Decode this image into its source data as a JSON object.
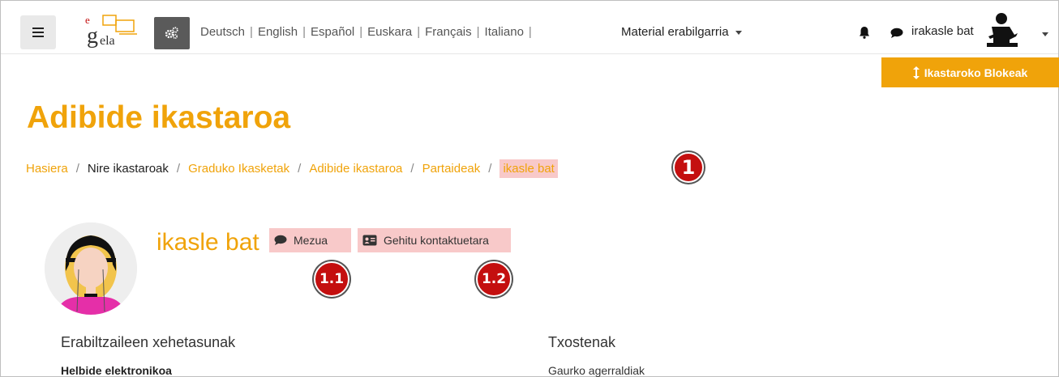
{
  "navbar": {
    "logo_text": "eGela",
    "languages": [
      "Deutsch",
      "English",
      "Español",
      "Euskara",
      "Français",
      "Italiano"
    ],
    "material_menu": "Material erabilgarria",
    "username": "irakasle bat"
  },
  "blocks_button": "Ikastaroko Blokeak",
  "page_title": "Adibide ikastaroa",
  "breadcrumb": [
    "Hasiera",
    "Nire ikastaroak",
    "Graduko Ikasketak",
    "Adibide ikastaroa",
    "Partaideak",
    "ikasle bat"
  ],
  "annotations": {
    "badge_1": "1",
    "badge_1_1": "1.1",
    "badge_1_2": "1.2",
    "highlight_color": "#f8c9c9",
    "badge_color": "#c40f0f"
  },
  "profile": {
    "name": "ikasle bat",
    "message_button": "Mezua",
    "add_contact_button": "Gehitu kontaktuetara"
  },
  "sections": {
    "user_details_heading": "Erabiltzaileen xehetasunak",
    "email_label": "Helbide elektronikoa",
    "reports_heading": "Txostenak",
    "todays_logs": "Gaurko agerraldiak"
  },
  "colors": {
    "accent": "#f0a30a"
  }
}
